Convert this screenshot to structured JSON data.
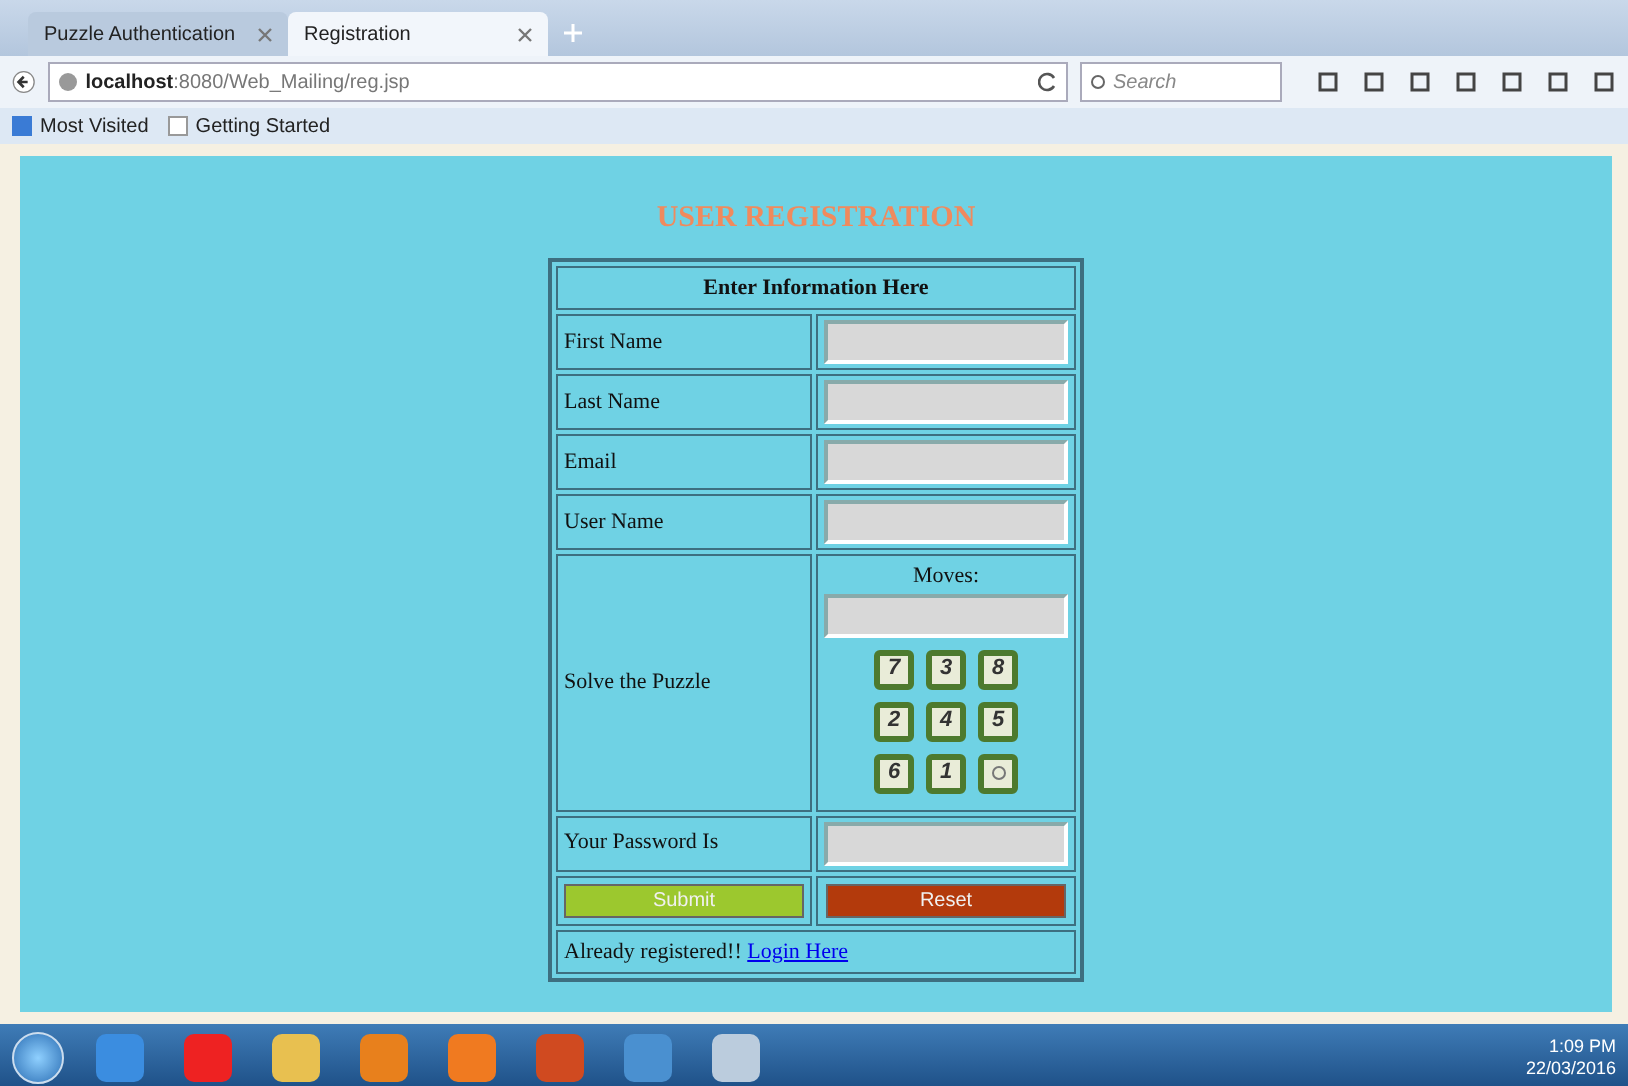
{
  "browser": {
    "tabs": [
      {
        "label": "Puzzle Authentication",
        "selected": false
      },
      {
        "label": "Registration",
        "selected": true
      }
    ],
    "address": "**localhost**:8080/Web_Mailing/reg.jsp",
    "search": {
      "placeholder": "Search"
    },
    "bookmarks": [
      "Most Visited",
      "Getting Started"
    ]
  },
  "page": {
    "title": "USER REGISTRATION",
    "form_heading": "Enter Information Here",
    "fields": [
      {
        "label": "First Name"
      },
      {
        "label": "Last Name"
      },
      {
        "label": "Email"
      },
      {
        "label": "User Name"
      }
    ],
    "puzzle": {
      "label": "Solve the Puzzle",
      "moves_label": "Moves:",
      "tiles": [
        {
          "kind": "number",
          "text": "7"
        },
        {
          "kind": "number",
          "text": "3"
        },
        {
          "kind": "number",
          "text": "8"
        },
        {
          "kind": "number",
          "text": "2"
        },
        {
          "kind": "number",
          "text": "4"
        },
        {
          "kind": "number",
          "text": "5"
        },
        {
          "kind": "number",
          "text": "6"
        },
        {
          "kind": "number",
          "text": "1"
        },
        {
          "kind": "blank"
        }
      ]
    },
    "password_label": "Your Password Is",
    "buttons": [
      {
        "label": "Submit",
        "kind": "submit"
      },
      {
        "label": "Reset",
        "kind": "reset"
      }
    ],
    "footer_text": "Already registered!!",
    "login_link": "Login Here"
  },
  "taskbar": {
    "time": "1:09 PM",
    "date": "22/03/2016"
  }
}
